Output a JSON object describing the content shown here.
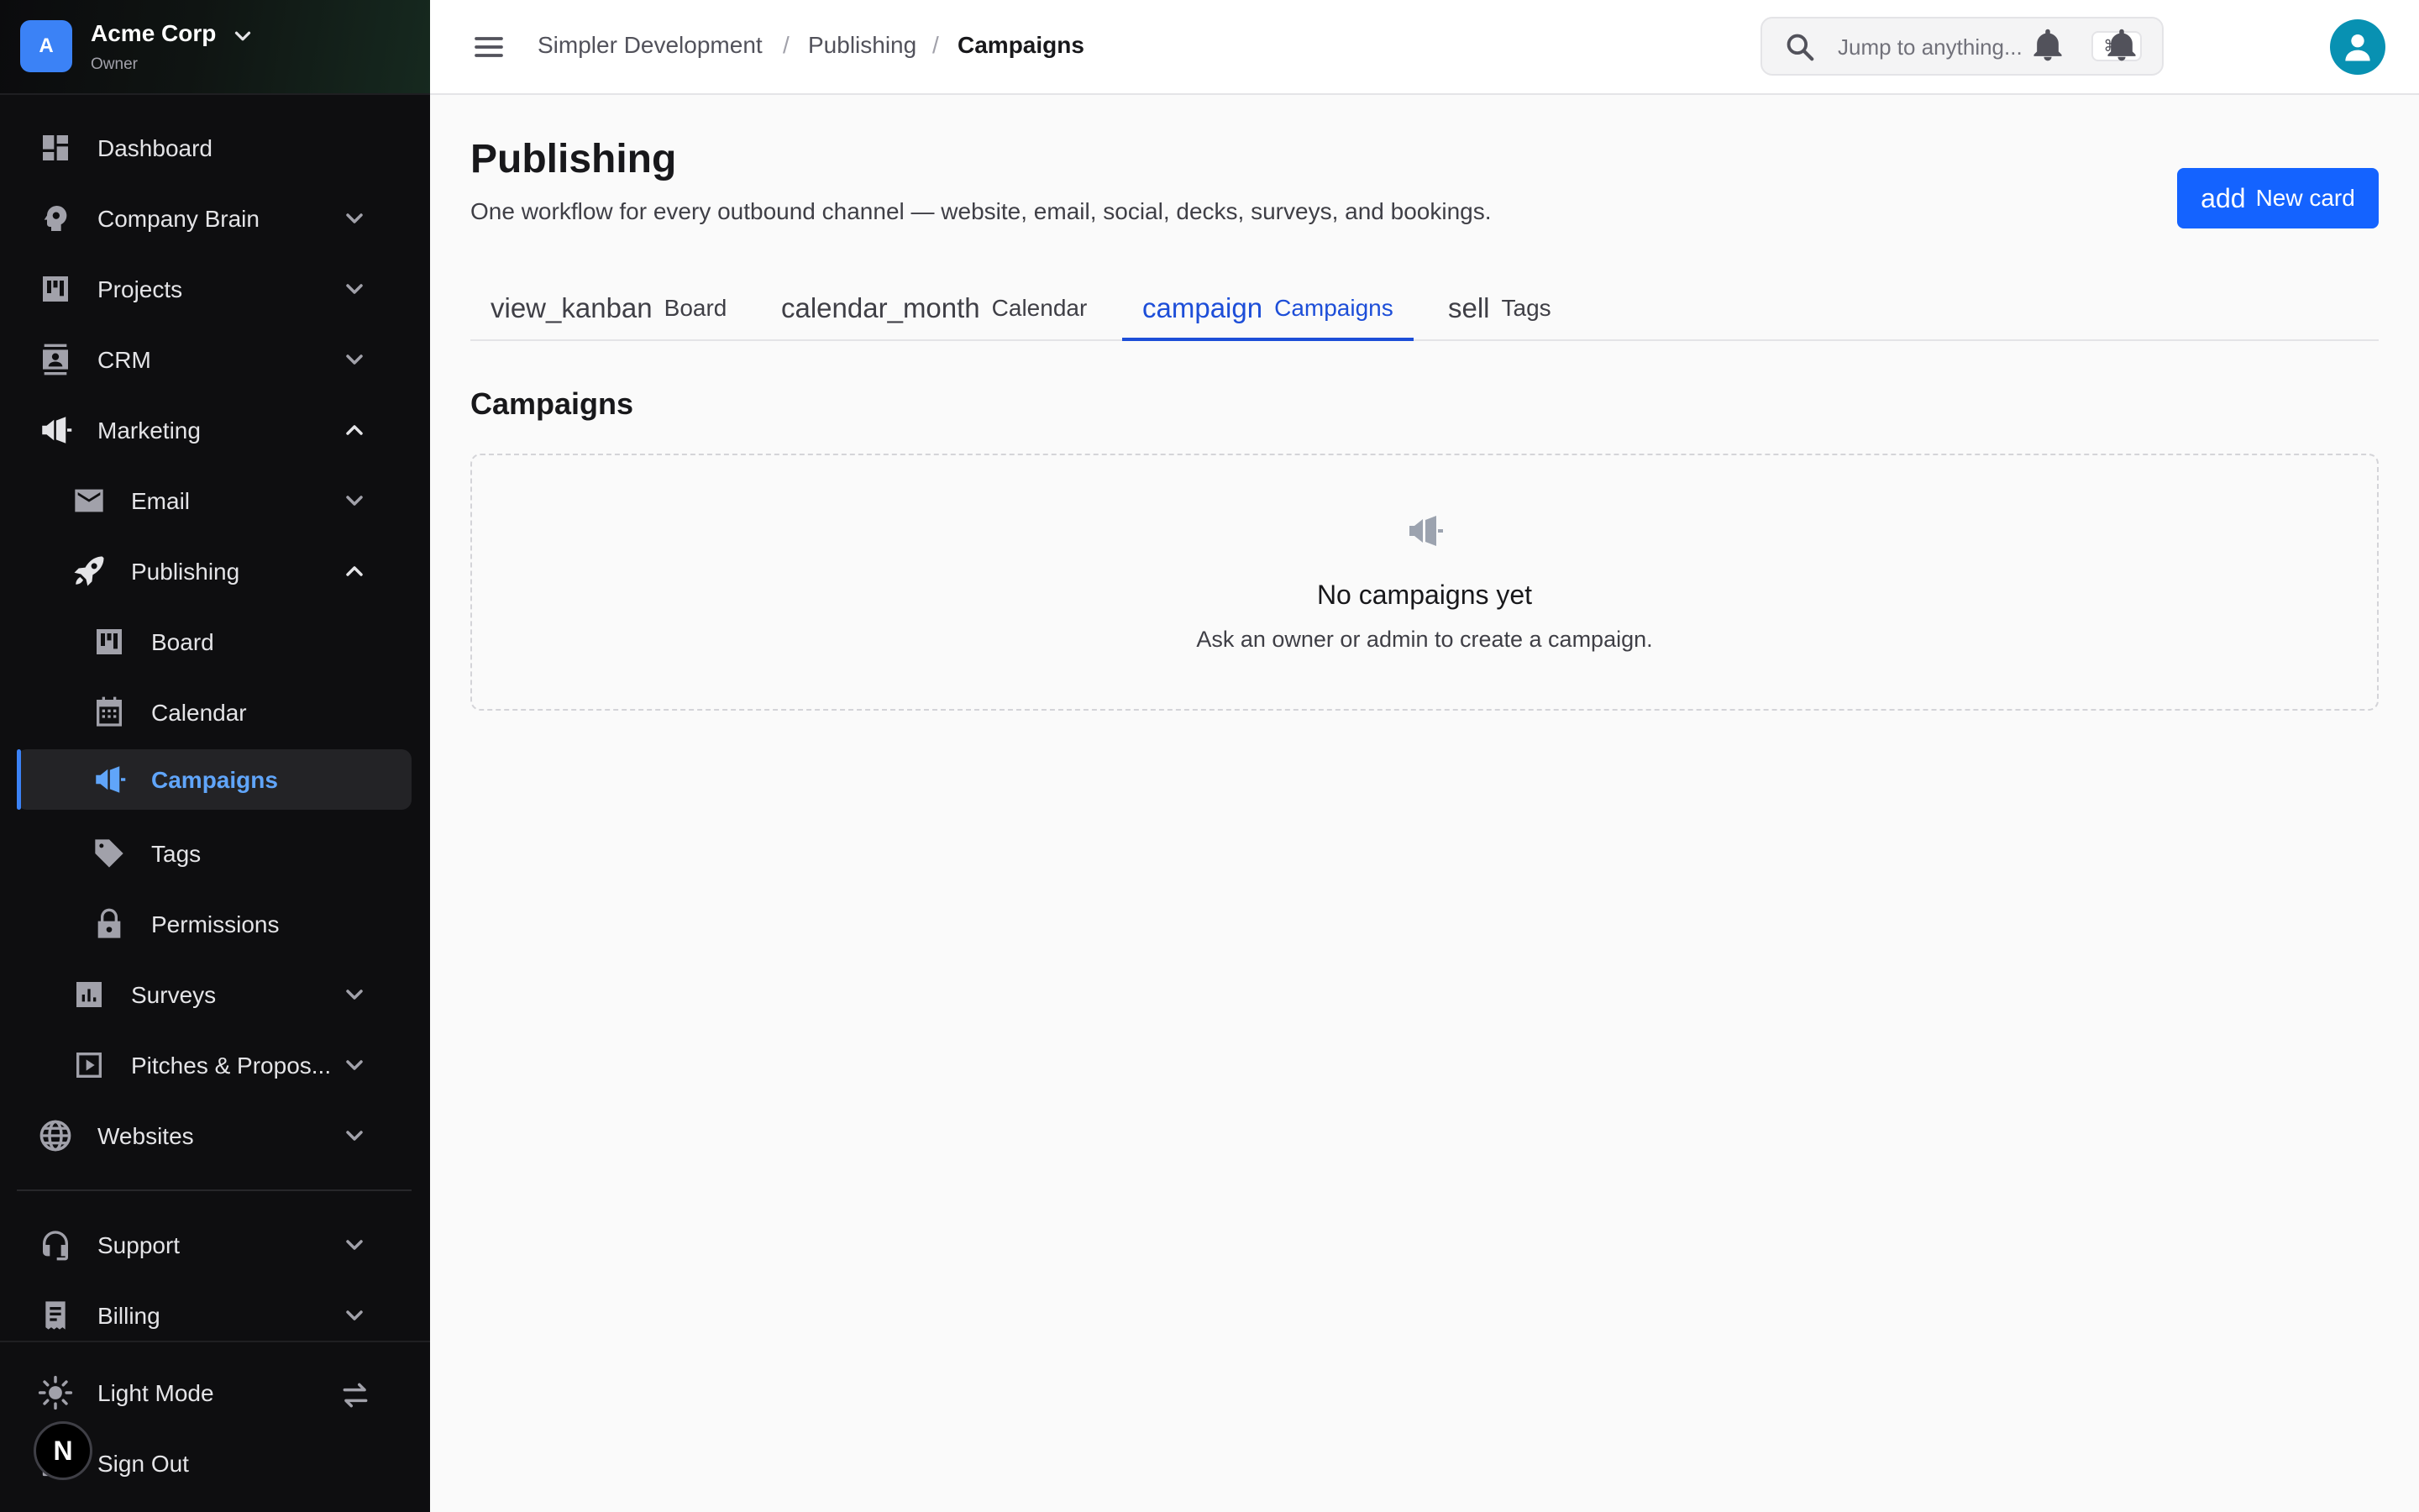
{
  "org": {
    "initial": "A",
    "name": "Acme Corp",
    "role": "Owner"
  },
  "sidebar": {
    "items": [
      {
        "label": "Dashboard"
      },
      {
        "label": "Company Brain"
      },
      {
        "label": "Projects"
      },
      {
        "label": "CRM"
      },
      {
        "label": "Marketing"
      },
      {
        "label": "Email"
      },
      {
        "label": "Publishing"
      },
      {
        "label": "Board"
      },
      {
        "label": "Calendar"
      },
      {
        "label": "Campaigns"
      },
      {
        "label": "Tags"
      },
      {
        "label": "Permissions"
      },
      {
        "label": "Surveys"
      },
      {
        "label": "Pitches & Propos..."
      },
      {
        "label": "Websites"
      },
      {
        "label": "Support"
      },
      {
        "label": "Billing"
      }
    ],
    "footer": {
      "theme_label": "Light Mode",
      "signout_label": "Sign Out",
      "badge": "N"
    }
  },
  "breadcrumb": [
    "Simpler Development",
    "Publishing",
    "Campaigns"
  ],
  "breadcrumb_sep": "/",
  "search": {
    "placeholder": "Jump to anything...",
    "shortcut": "⌘K"
  },
  "page": {
    "title": "Publishing",
    "subtitle": "One workflow for every outbound channel — website, email, social, decks, surveys, and bookings.",
    "new_button": {
      "icon": "add",
      "label": "New card"
    }
  },
  "tabs": [
    {
      "icon": "view_kanban",
      "label": "Board"
    },
    {
      "icon": "calendar_month",
      "label": "Calendar"
    },
    {
      "icon": "campaign",
      "label": "Campaigns"
    },
    {
      "icon": "sell",
      "label": "Tags"
    }
  ],
  "section": {
    "title": "Campaigns"
  },
  "empty_state": {
    "icon": "megaphone-icon",
    "title": "No campaigns yet",
    "message": "Ask an owner or admin to create a campaign."
  },
  "colors": {
    "accent": "#1463ff",
    "active_nav": "#60a5fa",
    "sidebar_bg": "#0e0e10",
    "avatar": "#0891b2"
  }
}
